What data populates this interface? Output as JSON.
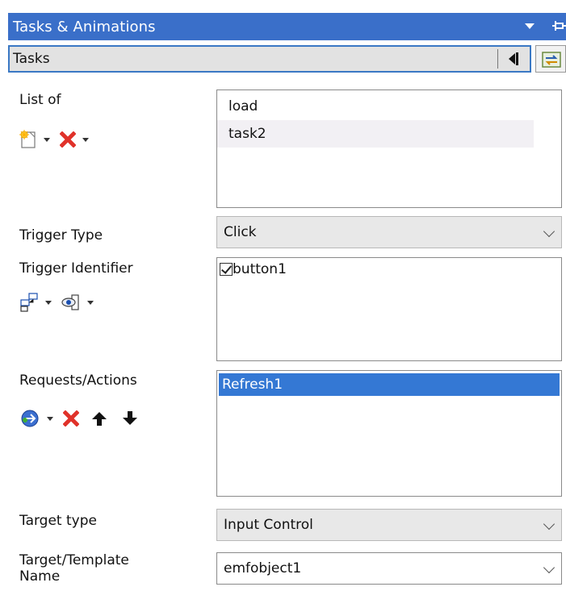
{
  "panel": {
    "title": "Tasks & Animations"
  },
  "header_combo": {
    "value": "Tasks"
  },
  "sections": {
    "list_of": {
      "label": "List of",
      "items": [
        "load",
        "task2"
      ]
    },
    "trigger_type": {
      "label": "Trigger Type",
      "value": "Click"
    },
    "trigger_identifier": {
      "label": "Trigger Identifier",
      "items": [
        {
          "label": "button1",
          "checked": true
        }
      ]
    },
    "requests_actions": {
      "label": "Requests/Actions",
      "items": [
        "Refresh1"
      ]
    },
    "target_type": {
      "label": "Target type",
      "value": "Input Control"
    },
    "target_name": {
      "label_line1": "Target/Template",
      "label_line2": "Name",
      "value": "emfobject1"
    }
  },
  "colors": {
    "title_bar": "#3a6fc9",
    "selection": "#3478d4",
    "delete": "#e0322a"
  }
}
